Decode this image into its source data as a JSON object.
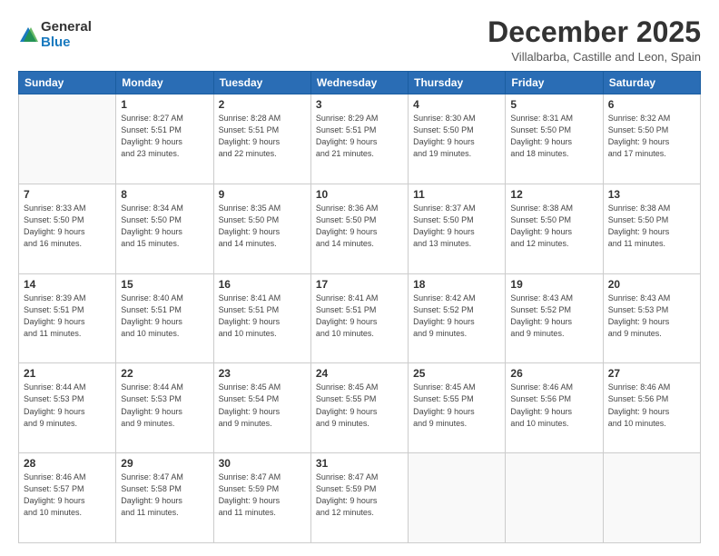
{
  "logo": {
    "general": "General",
    "blue": "Blue"
  },
  "title": "December 2025",
  "subtitle": "Villalbarba, Castille and Leon, Spain",
  "weekdays": [
    "Sunday",
    "Monday",
    "Tuesday",
    "Wednesday",
    "Thursday",
    "Friday",
    "Saturday"
  ],
  "weeks": [
    [
      {
        "day": "",
        "info": ""
      },
      {
        "day": "1",
        "info": "Sunrise: 8:27 AM\nSunset: 5:51 PM\nDaylight: 9 hours\nand 23 minutes."
      },
      {
        "day": "2",
        "info": "Sunrise: 8:28 AM\nSunset: 5:51 PM\nDaylight: 9 hours\nand 22 minutes."
      },
      {
        "day": "3",
        "info": "Sunrise: 8:29 AM\nSunset: 5:51 PM\nDaylight: 9 hours\nand 21 minutes."
      },
      {
        "day": "4",
        "info": "Sunrise: 8:30 AM\nSunset: 5:50 PM\nDaylight: 9 hours\nand 19 minutes."
      },
      {
        "day": "5",
        "info": "Sunrise: 8:31 AM\nSunset: 5:50 PM\nDaylight: 9 hours\nand 18 minutes."
      },
      {
        "day": "6",
        "info": "Sunrise: 8:32 AM\nSunset: 5:50 PM\nDaylight: 9 hours\nand 17 minutes."
      }
    ],
    [
      {
        "day": "7",
        "info": "Sunrise: 8:33 AM\nSunset: 5:50 PM\nDaylight: 9 hours\nand 16 minutes."
      },
      {
        "day": "8",
        "info": "Sunrise: 8:34 AM\nSunset: 5:50 PM\nDaylight: 9 hours\nand 15 minutes."
      },
      {
        "day": "9",
        "info": "Sunrise: 8:35 AM\nSunset: 5:50 PM\nDaylight: 9 hours\nand 14 minutes."
      },
      {
        "day": "10",
        "info": "Sunrise: 8:36 AM\nSunset: 5:50 PM\nDaylight: 9 hours\nand 14 minutes."
      },
      {
        "day": "11",
        "info": "Sunrise: 8:37 AM\nSunset: 5:50 PM\nDaylight: 9 hours\nand 13 minutes."
      },
      {
        "day": "12",
        "info": "Sunrise: 8:38 AM\nSunset: 5:50 PM\nDaylight: 9 hours\nand 12 minutes."
      },
      {
        "day": "13",
        "info": "Sunrise: 8:38 AM\nSunset: 5:50 PM\nDaylight: 9 hours\nand 11 minutes."
      }
    ],
    [
      {
        "day": "14",
        "info": "Sunrise: 8:39 AM\nSunset: 5:51 PM\nDaylight: 9 hours\nand 11 minutes."
      },
      {
        "day": "15",
        "info": "Sunrise: 8:40 AM\nSunset: 5:51 PM\nDaylight: 9 hours\nand 10 minutes."
      },
      {
        "day": "16",
        "info": "Sunrise: 8:41 AM\nSunset: 5:51 PM\nDaylight: 9 hours\nand 10 minutes."
      },
      {
        "day": "17",
        "info": "Sunrise: 8:41 AM\nSunset: 5:51 PM\nDaylight: 9 hours\nand 10 minutes."
      },
      {
        "day": "18",
        "info": "Sunrise: 8:42 AM\nSunset: 5:52 PM\nDaylight: 9 hours\nand 9 minutes."
      },
      {
        "day": "19",
        "info": "Sunrise: 8:43 AM\nSunset: 5:52 PM\nDaylight: 9 hours\nand 9 minutes."
      },
      {
        "day": "20",
        "info": "Sunrise: 8:43 AM\nSunset: 5:53 PM\nDaylight: 9 hours\nand 9 minutes."
      }
    ],
    [
      {
        "day": "21",
        "info": "Sunrise: 8:44 AM\nSunset: 5:53 PM\nDaylight: 9 hours\nand 9 minutes."
      },
      {
        "day": "22",
        "info": "Sunrise: 8:44 AM\nSunset: 5:53 PM\nDaylight: 9 hours\nand 9 minutes."
      },
      {
        "day": "23",
        "info": "Sunrise: 8:45 AM\nSunset: 5:54 PM\nDaylight: 9 hours\nand 9 minutes."
      },
      {
        "day": "24",
        "info": "Sunrise: 8:45 AM\nSunset: 5:55 PM\nDaylight: 9 hours\nand 9 minutes."
      },
      {
        "day": "25",
        "info": "Sunrise: 8:45 AM\nSunset: 5:55 PM\nDaylight: 9 hours\nand 9 minutes."
      },
      {
        "day": "26",
        "info": "Sunrise: 8:46 AM\nSunset: 5:56 PM\nDaylight: 9 hours\nand 10 minutes."
      },
      {
        "day": "27",
        "info": "Sunrise: 8:46 AM\nSunset: 5:56 PM\nDaylight: 9 hours\nand 10 minutes."
      }
    ],
    [
      {
        "day": "28",
        "info": "Sunrise: 8:46 AM\nSunset: 5:57 PM\nDaylight: 9 hours\nand 10 minutes."
      },
      {
        "day": "29",
        "info": "Sunrise: 8:47 AM\nSunset: 5:58 PM\nDaylight: 9 hours\nand 11 minutes."
      },
      {
        "day": "30",
        "info": "Sunrise: 8:47 AM\nSunset: 5:59 PM\nDaylight: 9 hours\nand 11 minutes."
      },
      {
        "day": "31",
        "info": "Sunrise: 8:47 AM\nSunset: 5:59 PM\nDaylight: 9 hours\nand 12 minutes."
      },
      {
        "day": "",
        "info": ""
      },
      {
        "day": "",
        "info": ""
      },
      {
        "day": "",
        "info": ""
      }
    ]
  ]
}
